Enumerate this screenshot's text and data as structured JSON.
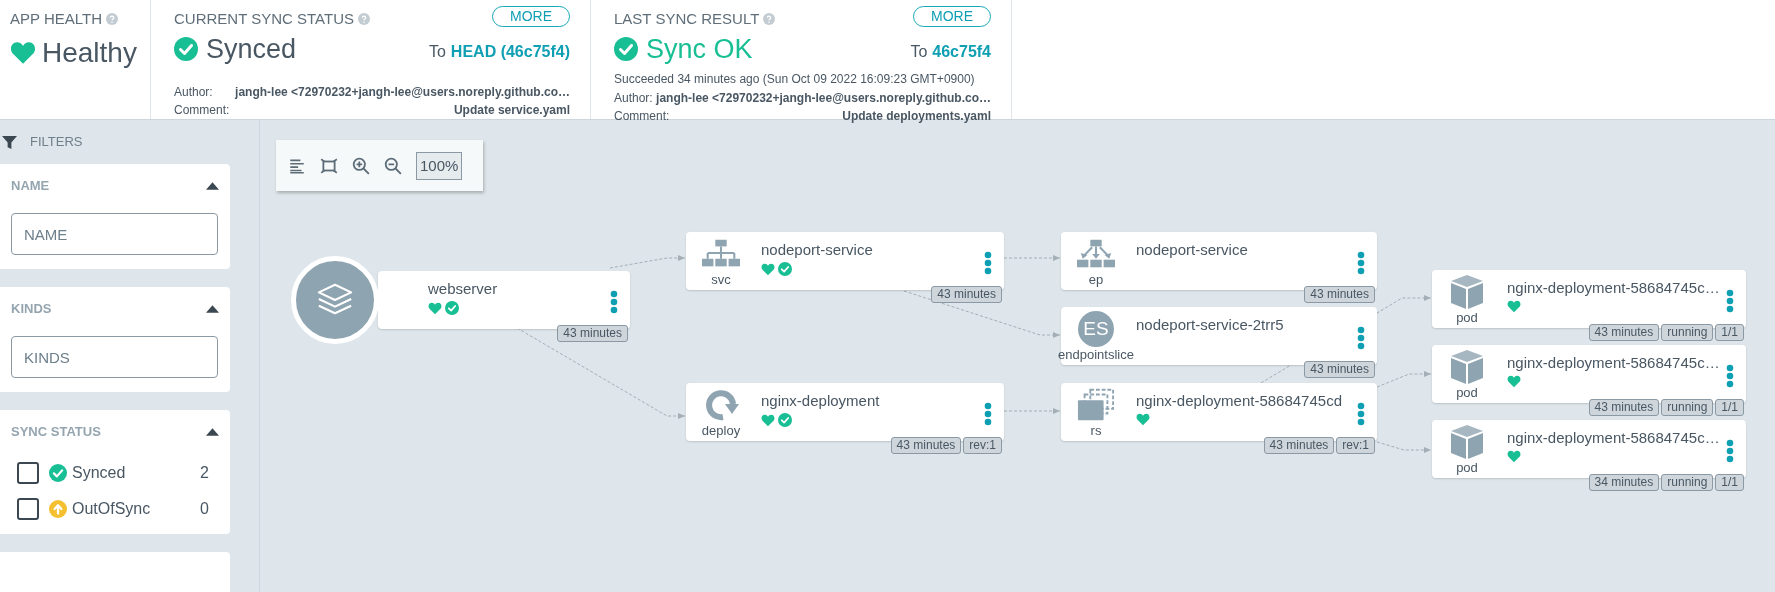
{
  "app_health": {
    "label": "APP HEALTH",
    "healthy": true,
    "status": "Healthy"
  },
  "current_sync_status": {
    "label": "CURRENT SYNC STATUS",
    "more_button": "MORE",
    "synced": true,
    "status": "Synced",
    "to_prefix": "To",
    "revision": "HEAD (46c75f4)",
    "author_label": "Author:",
    "author": "jangh-lee <72970232+jangh-lee@users.noreply.github.co…",
    "comment_label": "Comment:",
    "comment": "Update service.yaml"
  },
  "last_sync_result": {
    "label": "LAST SYNC RESULT",
    "more_button": "MORE",
    "synced": true,
    "status": "Sync OK",
    "to_prefix": "To",
    "revision": "46c75f4",
    "succeeded": "Succeeded 34 minutes ago (Sun Oct 09 2022 16:09:23 GMT+0900)",
    "author_label": "Author:",
    "author": "jangh-lee <72970232+jangh-lee@users.noreply.github.co…",
    "comment_label": "Comment:",
    "comment": "Update deployments.yaml"
  },
  "filters": {
    "title": "FILTERS",
    "sections": [
      {
        "kind": "text",
        "title": "NAME",
        "expanded": true,
        "placeholder": "NAME"
      },
      {
        "kind": "text",
        "title": "KINDS",
        "expanded": true,
        "placeholder": "KINDS"
      },
      {
        "kind": "checklist",
        "title": "SYNC STATUS",
        "expanded": true,
        "options": [
          {
            "kind": "synced",
            "label": "Synced",
            "checked": false,
            "count": "2"
          },
          {
            "kind": "outofsync",
            "label": "OutOfSync",
            "checked": false,
            "count": "0"
          }
        ]
      }
    ]
  },
  "toolbar": {
    "zoom": "100%"
  },
  "nodes": [
    {
      "kind": "app",
      "name": "webserver",
      "healthy": true,
      "synced": true,
      "badges": [
        "43 minutes"
      ]
    },
    {
      "kind": "svc",
      "type_label": "svc",
      "name": "nodeport-service",
      "healthy": true,
      "synced": true,
      "badges": [
        "43 minutes"
      ]
    },
    {
      "kind": "deploy",
      "type_label": "deploy",
      "name": "nginx-deployment",
      "healthy": true,
      "synced": true,
      "badges": [
        "43 minutes",
        "rev:1"
      ]
    },
    {
      "kind": "ep",
      "type_label": "ep",
      "name": "nodeport-service",
      "badges": [
        "43 minutes"
      ]
    },
    {
      "kind": "endpointslice",
      "icon_text": "ES",
      "type_label": "endpointslice",
      "name": "nodeport-service-2trr5",
      "badges": [
        "43 minutes"
      ]
    },
    {
      "kind": "rs",
      "type_label": "rs",
      "name": "nginx-deployment-58684745cd",
      "healthy": true,
      "badges": [
        "43 minutes",
        "rev:1"
      ]
    },
    {
      "kind": "pod",
      "type_label": "pod",
      "name": "nginx-deployment-58684745c…",
      "healthy": true,
      "badges": [
        "43 minutes",
        "running",
        "1/1"
      ]
    },
    {
      "kind": "pod",
      "type_label": "pod",
      "name": "nginx-deployment-58684745c…",
      "healthy": true,
      "badges": [
        "43 minutes",
        "running",
        "1/1"
      ]
    },
    {
      "kind": "pod",
      "type_label": "pod",
      "name": "nginx-deployment-58684745c…",
      "healthy": true,
      "badges": [
        "34 minutes",
        "running",
        "1/1"
      ]
    }
  ]
}
